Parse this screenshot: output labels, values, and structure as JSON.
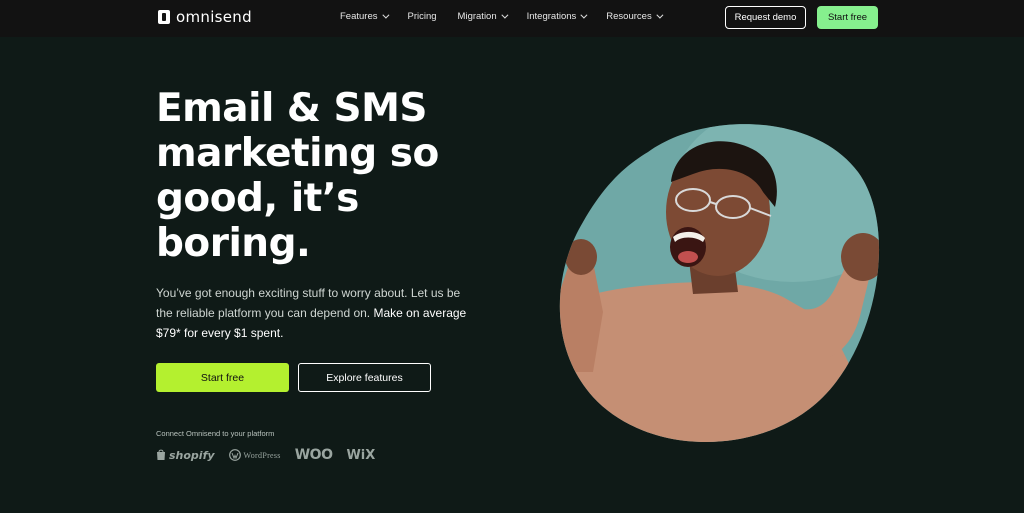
{
  "nav": {
    "logo_text": "omnisend",
    "links": [
      {
        "label": "Features",
        "has_dropdown": true
      },
      {
        "label": "Pricing",
        "has_dropdown": false
      },
      {
        "label": "Migration",
        "has_dropdown": true
      },
      {
        "label": "Integrations",
        "has_dropdown": true
      },
      {
        "label": "Resources",
        "has_dropdown": true
      }
    ],
    "request_demo_label": "Request demo",
    "start_free_label": "Start free"
  },
  "hero": {
    "headline_lines": [
      "Email & SMS",
      "marketing so",
      "good, it’s",
      "boring."
    ],
    "subtext": "You’ve got enough exciting stuff to worry about. Let us be the reliable platform you can depend on.",
    "subtext_bold": "Make on average $79* for every $1 spent.",
    "start_free_label": "Start free",
    "explore_label": "Explore features",
    "image_desc_icon": "cheering-man-photo"
  },
  "platforms": {
    "label": "Connect Omnisend to your platform",
    "items": [
      "shopify",
      "WordPress",
      "WOO",
      "WiX"
    ]
  },
  "colors": {
    "background": "#0f1a17",
    "nav_bg": "#121212",
    "hero_cta": "#b4f02f",
    "nav_cta": "#86f08e",
    "photo_bg": "#6fa8a6"
  }
}
